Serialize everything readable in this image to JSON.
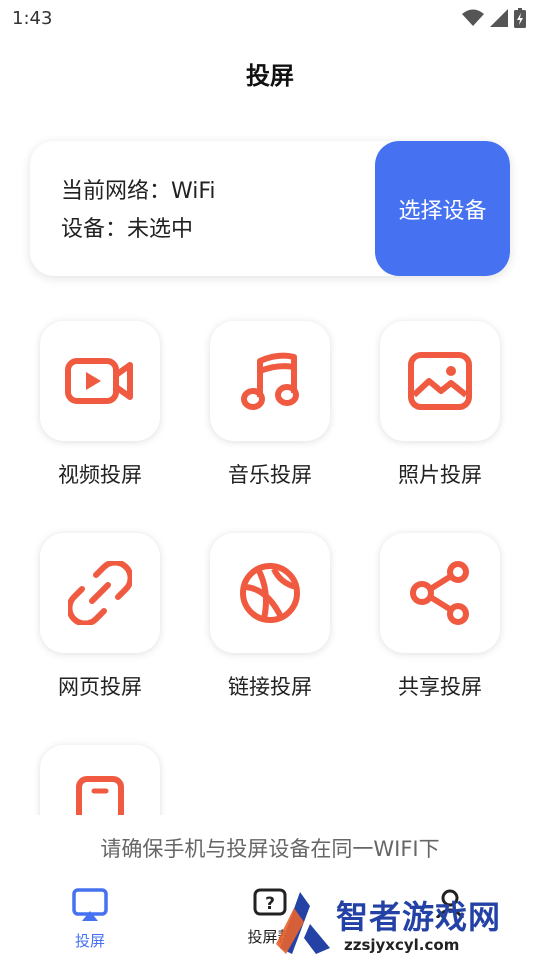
{
  "status_bar": {
    "time": "1:43"
  },
  "header": {
    "title": "投屏"
  },
  "info_card": {
    "network_line": "当前网络：WiFi",
    "device_line": "设备：未选中",
    "select_button": "选择设备"
  },
  "grid": {
    "items": [
      {
        "label": "视频投屏",
        "icon": "video-camera-icon"
      },
      {
        "label": "音乐投屏",
        "icon": "music-note-icon"
      },
      {
        "label": "照片投屏",
        "icon": "image-icon"
      },
      {
        "label": "网页投屏",
        "icon": "link-icon"
      },
      {
        "label": "链接投屏",
        "icon": "ball-icon"
      },
      {
        "label": "共享投屏",
        "icon": "share-icon"
      },
      {
        "label": "",
        "icon": "phone-icon"
      }
    ]
  },
  "hint": "请确保手机与投屏设备在同一WIFI下",
  "bottom_nav": {
    "items": [
      {
        "label": "投屏",
        "icon": "cast-icon"
      },
      {
        "label": "投屏帮",
        "icon": "help-icon"
      },
      {
        "label": "",
        "icon": "user-icon"
      }
    ]
  },
  "watermark": {
    "title": "智者游戏网",
    "url": "zzsjyxcyl.com"
  },
  "colors": {
    "accent": "#4672f1",
    "icon_red": "#ef5a40",
    "text": "#222222",
    "hint": "#666666"
  }
}
